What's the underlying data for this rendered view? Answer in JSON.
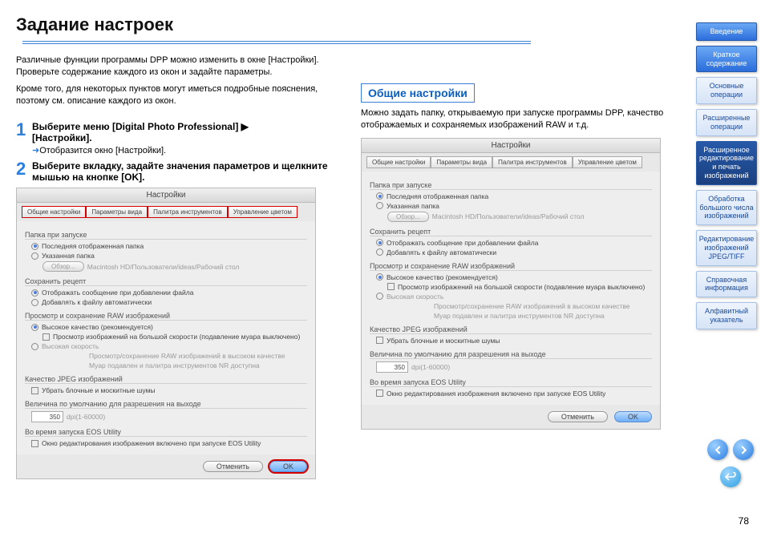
{
  "page_number": "78",
  "title": "Задание настроек",
  "intro_p1": "Различные функции программы DPP можно изменить в окне [Настройки]. Проверьте содержание каждого из окон и задайте параметры.",
  "intro_p2": "Кроме того, для некоторых пунктов могут иметься подробные пояснения, поэтому см. описание каждого из окон.",
  "step1_line1": "Выберите меню [Digital Photo Professional] ▶",
  "step1_line2": "[Настройки].",
  "step1_note": "Отобразится окно [Настройки].",
  "step2_line1": "Выберите вкладку, задайте значения параметров и щелкните мышью на кнопке [OK].",
  "subtitle": "Общие настройки",
  "sub_desc": "Можно задать папку, открываемую при запуске программы DPP, качество отображаемых и сохраняемых изображений RAW и т.д.",
  "shot": {
    "window_title": "Настройки",
    "tabs": [
      "Общие настройки",
      "Параметры вида",
      "Палитра инструментов",
      "Управление цветом"
    ],
    "s1": "Папка при запуске",
    "r1": "Последняя отображенная папка",
    "r2": "Указанная папка",
    "browse": "Обзор...",
    "path": "Macintosh HD/Пользователи/ideas/Рабочий стол",
    "s2": "Сохранить рецепт",
    "c1": "Отображать сообщение при добавлении файла",
    "c2": "Добавлять к файлу автоматически",
    "s3": "Просмотр и сохранение RAW изображений",
    "r3": "Высокое качество (рекомендуется)",
    "c3": "Просмотр изображений на большой скорости (подавление муара выключено)",
    "r4": "Высокая скорость",
    "r4a": "Просмотр/сохранение RAW изображений в высоком качестве",
    "r4b": "Муар подавлен и палитра инструментов NR доступна",
    "s4": "Качество JPEG изображений",
    "c4": "Убрать блочные и москитные шумы",
    "s5": "Величина по умолчанию для разрешения на выходе",
    "num": "350",
    "unit": "dpi(1-60000)",
    "s6": "Во время запуска EOS Utility",
    "c5": "Окно редактирования изображения включено при запуске EOS Utility",
    "cancel": "Отменить",
    "ok": "OK"
  },
  "nav": [
    {
      "label": "Введение",
      "cls": "nav-btn"
    },
    {
      "label": "Краткое содержание",
      "cls": "nav-btn"
    },
    {
      "label": "Основные операции",
      "cls": "nav-btn light"
    },
    {
      "label": "Расширенные операции",
      "cls": "nav-btn light"
    },
    {
      "label": "Расширенное редактирование и печать изображений",
      "cls": "nav-btn active"
    },
    {
      "label": "Обработка большого числа изображений",
      "cls": "nav-btn light"
    },
    {
      "label": "Редактирование изображений JPEG/TIFF",
      "cls": "nav-btn light"
    },
    {
      "label": "Справочная информация",
      "cls": "nav-btn light"
    },
    {
      "label": "Алфавитный указатель",
      "cls": "nav-btn light"
    }
  ]
}
